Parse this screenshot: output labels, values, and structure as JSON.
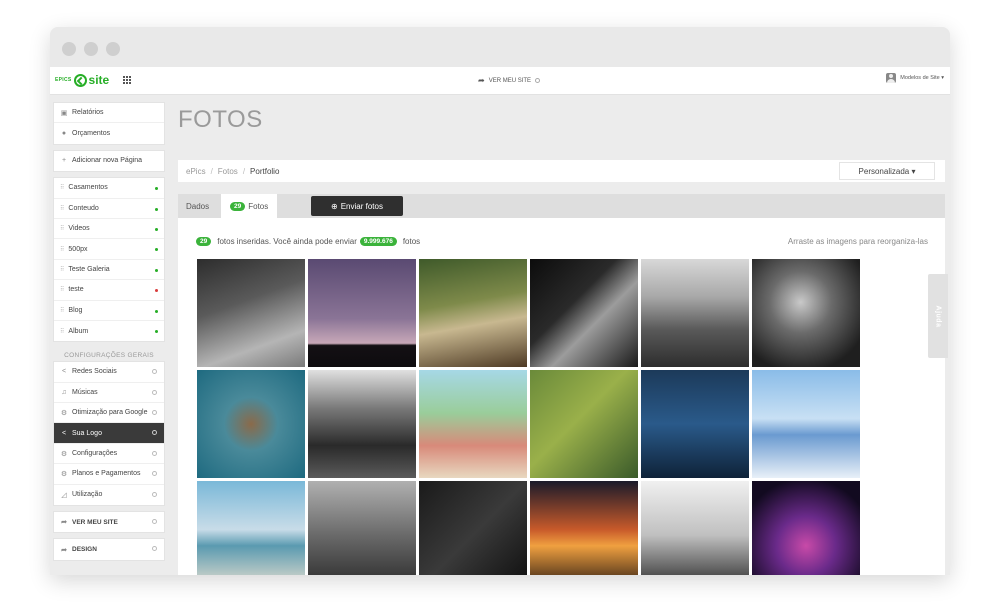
{
  "topbar": {
    "logo_prefix": "EPICS",
    "logo_text": "site",
    "view_site": "VER MEU SITE",
    "user_menu": "Modelos de Site ▾"
  },
  "sidebar": {
    "top_items": [
      {
        "icon": "image-icon",
        "glyph": "▣",
        "label": "Relatórios"
      },
      {
        "icon": "chat-icon",
        "glyph": "●",
        "label": "Orçamentos"
      }
    ],
    "add_page": {
      "glyph": "+",
      "label": "Adicionar nova Página"
    },
    "pages": [
      {
        "label": "Casamentos",
        "status_color": "#27ae27"
      },
      {
        "label": "Conteudo",
        "status_color": "#27ae27"
      },
      {
        "label": "Videos",
        "status_color": "#27ae27"
      },
      {
        "label": "500px",
        "status_color": "#27ae27"
      },
      {
        "label": "Teste Galeria",
        "status_color": "#27ae27"
      },
      {
        "label": "teste",
        "status_color": "#d93c3c"
      },
      {
        "label": "Blog",
        "status_color": "#27ae27"
      },
      {
        "label": "Album",
        "status_color": "#27ae27"
      }
    ],
    "settings_title": "CONFIGURAÇÕES GERAIS",
    "settings": [
      {
        "icon": "share-icon",
        "glyph": "<",
        "label": "Redes Sociais"
      },
      {
        "icon": "music-icon",
        "glyph": "♫",
        "label": "Músicas"
      },
      {
        "icon": "cogs-icon",
        "glyph": "⚙",
        "label": "Otimização para Google"
      },
      {
        "icon": "share-icon",
        "glyph": "<",
        "label": "Sua Logo",
        "active": true
      },
      {
        "icon": "cogs-icon",
        "glyph": "⚙",
        "label": "Configurações"
      },
      {
        "icon": "cogs-icon",
        "glyph": "⚙",
        "label": "Planos e Pagamentos"
      },
      {
        "icon": "chart-icon",
        "glyph": "◿",
        "label": "Utilização"
      }
    ],
    "view_site": "VER MEU SITE",
    "design": "DESIGN"
  },
  "main": {
    "title": "FOTOS",
    "breadcrumb": [
      "ePics",
      "Fotos",
      "Portfolio"
    ],
    "sort_dropdown": "Personalizada ▾",
    "tab_dados": "Dados",
    "tab_fotos_count": "29",
    "tab_fotos_label": "Fotos",
    "upload_button": "Enviar fotos",
    "info_count": "29",
    "info_text": "fotos inseridas. Você ainda pode enviar",
    "info_remaining": "9.999.676",
    "info_suffix": "fotos",
    "drag_hint": "Arraste as imagens para reorganiza-las"
  },
  "photos": [
    {
      "name": "forest-wedding-couple",
      "bg": "linear-gradient(160deg,#2d2d2d 0%,#5a5a5a 40%,#b5b5b5 75%,#7a7a7a 100%)"
    },
    {
      "name": "graduation-caps-sky",
      "bg": "linear-gradient(180deg,#5a4a72 0%,#8a7496 55%,#c8a8b8 78%,#141014 80%,#0d0b0e 100%)"
    },
    {
      "name": "bride-under-trees",
      "bg": "linear-gradient(170deg,#3f5a2a 0%,#7e8a4a 40%,#c8b890 60%,#4e3a24 100%)"
    },
    {
      "name": "wedding-dress-detail",
      "bg": "linear-gradient(135deg,#0c0c0c 0%,#2a2a2a 40%,#9c9c9c 60%,#1a1a1a 100%)"
    },
    {
      "name": "cactus-landscape",
      "bg": "linear-gradient(180deg,#d8d8d8 0%,#a8a8a8 35%,#5a5a5a 65%,#2d2d2d 100%)"
    },
    {
      "name": "bride-portrait",
      "bg": "radial-gradient(circle at 45% 40%,#c9c9c9 0%,#6b6b6b 35%,#1f1f1f 80%)"
    },
    {
      "name": "aerial-shipwreck-sea",
      "bg": "radial-gradient(ellipse at 50% 50%,#8a6a4a 0%,#4a8a9a 35%,#1e6a80 100%)"
    },
    {
      "name": "wedding-ceremony-aisle",
      "bg": "linear-gradient(180deg,#e0e0e0 0%,#7a7a7a 35%,#2a2a2a 70%,#5a5a5a 100%)"
    },
    {
      "name": "beach-wedding-celebration",
      "bg": "linear-gradient(180deg,#a6d8e6 0%,#9acd9a 40%,#d88a7a 70%,#e8d8c0 100%)"
    },
    {
      "name": "aerial-green-field",
      "bg": "linear-gradient(135deg,#6a8a3a 0%,#9ab04a 45%,#3a5a2a 100%)"
    },
    {
      "name": "couple-ocean-night",
      "bg": "linear-gradient(180deg,#1c3a5a 0%,#2a5a8a 50%,#0e2238 100%)"
    },
    {
      "name": "couple-salt-flats",
      "bg": "linear-gradient(180deg,#8abce8 0%,#c8e0f4 45%,#6a9ad0 60%,#e8f0f8 100%)"
    },
    {
      "name": "beach-bride-walk",
      "bg": "linear-gradient(180deg,#7ab8d8 0%,#c8dce8 45%,#5a9ab0 60%,#e8e0d0 100%)"
    },
    {
      "name": "rocky-coast-bw",
      "bg": "linear-gradient(180deg,#b0b0b0 0%,#6a6a6a 50%,#2a2a2a 100%)"
    },
    {
      "name": "dark-abstract-bw",
      "bg": "linear-gradient(135deg,#1a1a1a 0%,#3a3a3a 50%,#0e0e0e 100%)"
    },
    {
      "name": "sunset-couple-silhouette",
      "bg": "linear-gradient(180deg,#1a1a2a 0%,#c85a2a 45%,#f0a040 60%,#2a1a12 100%)"
    },
    {
      "name": "couple-rocks-bw",
      "bg": "linear-gradient(180deg,#f0f0f0 0%,#c0c0c0 50%,#2a2a2a 100%)"
    },
    {
      "name": "night-party-lights",
      "bg": "radial-gradient(circle at 50% 60%,#c84aa8 0%,#6a2a8a 35%,#120a20 80%)"
    }
  ],
  "help_tab": "Ajuda"
}
